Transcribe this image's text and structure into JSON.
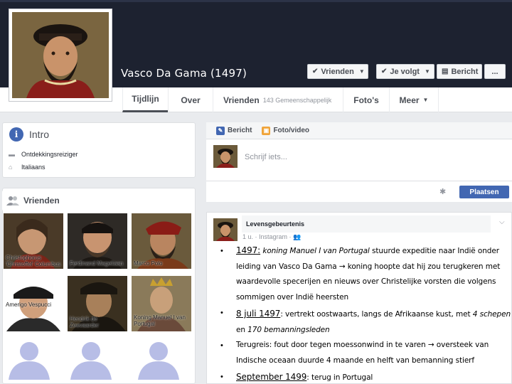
{
  "profile": {
    "name": "Vasco Da Gama (1497)"
  },
  "actions": {
    "friends_label": "Vrienden",
    "following_label": "Je volgt",
    "message_label": "Bericht",
    "more_label": "..."
  },
  "nav": {
    "tabs": [
      {
        "label": "Tijdlijn"
      },
      {
        "label": "Over"
      },
      {
        "label": "Vrienden",
        "sub": "143 Gemeenschappelijk"
      },
      {
        "label": "Foto's"
      },
      {
        "label": "Meer"
      }
    ]
  },
  "intro": {
    "title": "Intro",
    "items": [
      "Ontdekkingsreiziger",
      "Italiaans"
    ]
  },
  "friends": {
    "title": "Vrienden",
    "list": [
      {
        "name": "Christophorus 'Christoffel' Columbus"
      },
      {
        "name": "Ferdinand Magellaan"
      },
      {
        "name": "Marco Polo"
      },
      {
        "name": "Amerigo Vespucci"
      },
      {
        "name": "Hendrik de Zeevaarder"
      },
      {
        "name": "Koning Manuel I van Portugal"
      }
    ]
  },
  "composer": {
    "tab_message": "Bericht",
    "tab_photo": "Foto/video",
    "placeholder": "Schrijf iets...",
    "post_label": "Plaatsen"
  },
  "life_events": {
    "title": "Levensgebeurtenis",
    "meta": "1 u. · Instagram ·",
    "events": [
      {
        "date": "1497:",
        "italic": "koning Manuel I van Portugal",
        "text1": " stuurde expeditie naar Indië onder leiding van Vasco Da Gama ",
        "arrow": "→",
        "text2": " koning hoopte dat hij zou terugkeren met waardevolle specerijen en nieuws over Christelijke vorsten die volgens sommigen over Indië heersten"
      },
      {
        "date": "8 juli 1497",
        "text1": ": vertrekt oostwaarts, langs de Afrikaanse kust, met ",
        "italic1": "4 schepen",
        "text2": " en ",
        "italic2": "170 bemanningsleden"
      },
      {
        "text1": "Terugreis: fout door tegen moessonwind in te varen ",
        "arrow": "→",
        "text2": " oversteek van Indische oceaan duurde 4 maande en helft van bemanning stierf"
      },
      {
        "date": "September 1499",
        "text1": ": terug in Portugal"
      }
    ]
  }
}
